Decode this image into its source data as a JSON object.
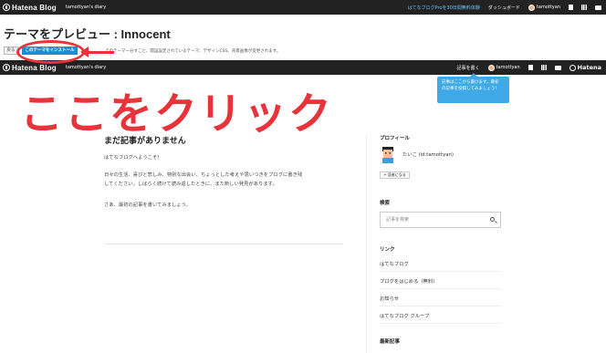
{
  "top_bar": {
    "logo_text": "Hatena Blog",
    "blog_name": "tamottyan's diary",
    "pro_link": "はてなブログProを30日間無料体験",
    "dashboard": "ダッシュボード",
    "user": "tamottyan"
  },
  "preview": {
    "title": "テーマをプレビュー : Innocent",
    "back_button": "戻る",
    "install_button": "このテーマをインストール",
    "description": "でのテーマ一分すこと、開設設定されているテーマ、デザインCSS、背景画像が変更されます。"
  },
  "blog_bar": {
    "logo_text": "Hatena Blog",
    "blog_name": "tamottyan's diary",
    "write_button": "記事を書く",
    "user": "tamottyan",
    "right_logo": "Hatena"
  },
  "annotation": {
    "big_text": "ここをクリック",
    "color": "#e8333a"
  },
  "tooltip": {
    "line1": "記事はここから書けます。最初",
    "line2": "の記事を投稿してみましょう！"
  },
  "post": {
    "title": "まだ記事がありません",
    "p1": "はてなブログへようこそ！",
    "p2a": "日々の生活、喜びと悲しみ、特別な出会い、ちょっとした考えや思いつきをブログに書き残",
    "p2b": "してください。しばらく続けて読み返したときに、また新しい発見があります。",
    "p3": "さあ、最初の記事を書いてみましょう。"
  },
  "sidebar": {
    "profile_heading": "プロフィール",
    "profile_name": "たいこ (id:tamottyan)",
    "reader_button": "読者になる",
    "search_heading": "検索",
    "search_placeholder": "記事を検索",
    "links_heading": "リンク",
    "links": [
      "はてなブログ",
      "ブログをはじめる（無料）",
      "お知らせ",
      "はてなブログ グループ"
    ],
    "recent_heading": "最新記事"
  }
}
